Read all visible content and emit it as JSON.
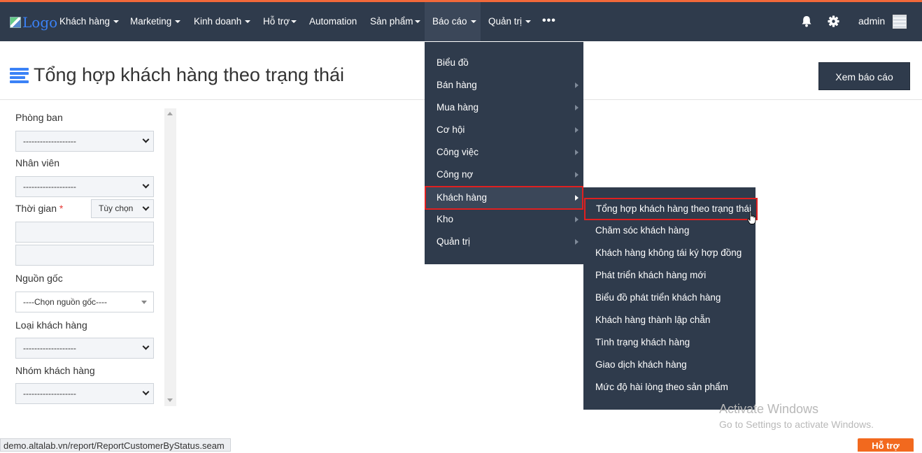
{
  "navbar": {
    "logo_alt": "Logo",
    "items": [
      {
        "label": "Khách hàng"
      },
      {
        "label": "Marketing"
      },
      {
        "label": "Kinh doanh"
      },
      {
        "label": "Hỗ trợ"
      },
      {
        "label": "Automation"
      },
      {
        "label": "Sản phẩm"
      },
      {
        "label": "Báo cáo"
      },
      {
        "label": "Quản trị"
      }
    ],
    "more": "•••",
    "user": "admin"
  },
  "page": {
    "title": "Tổng hợp khách hàng theo trạng thái",
    "view_button": "Xem báo cáo"
  },
  "filters": {
    "department_label": "Phòng ban",
    "department_value": "-------------------",
    "staff_label": "Nhân viên",
    "staff_value": "-------------------",
    "time_label": "Thời gian",
    "time_required": "*",
    "time_mode": "Tùy chọn",
    "source_label": "Nguồn gốc",
    "source_value": "----Chọn nguồn gốc----",
    "customer_type_label": "Loại khách hàng",
    "customer_type_value": "-------------------",
    "customer_group_label": "Nhóm khách hàng",
    "customer_group_value": "-------------------"
  },
  "report_menu": {
    "items": [
      {
        "label": "Biểu đồ"
      },
      {
        "label": "Bán hàng"
      },
      {
        "label": "Mua hàng"
      },
      {
        "label": "Cơ hội"
      },
      {
        "label": "Công việc"
      },
      {
        "label": "Công nợ"
      },
      {
        "label": "Khách hàng"
      },
      {
        "label": "Kho"
      },
      {
        "label": "Quản trị"
      }
    ]
  },
  "customer_submenu": {
    "items": [
      {
        "label": "Tổng hợp khách hàng theo trạng thái"
      },
      {
        "label": "Chăm sóc khách hàng"
      },
      {
        "label": "Khách hàng không tái ký hợp đồng"
      },
      {
        "label": "Phát triển khách hàng mới"
      },
      {
        "label": "Biểu đồ phát triển khách hàng"
      },
      {
        "label": "Khách hàng thành lập chẵn"
      },
      {
        "label": "Tình trạng khách hàng"
      },
      {
        "label": "Giao dịch khách hàng"
      },
      {
        "label": "Mức độ hài lòng theo sản phẩm"
      }
    ]
  },
  "watermark": {
    "line1": "Activate Windows",
    "line2": "Go to Settings to activate Windows."
  },
  "status_url": "demo.altalab.vn/report/ReportCustomerByStatus.seam",
  "support_button": "Hỗ trợ",
  "colors": {
    "navbar": "#2f3b4c",
    "accent_stripe": "#f2693a",
    "highlight_outline": "#e02020",
    "support": "#f2691e"
  }
}
